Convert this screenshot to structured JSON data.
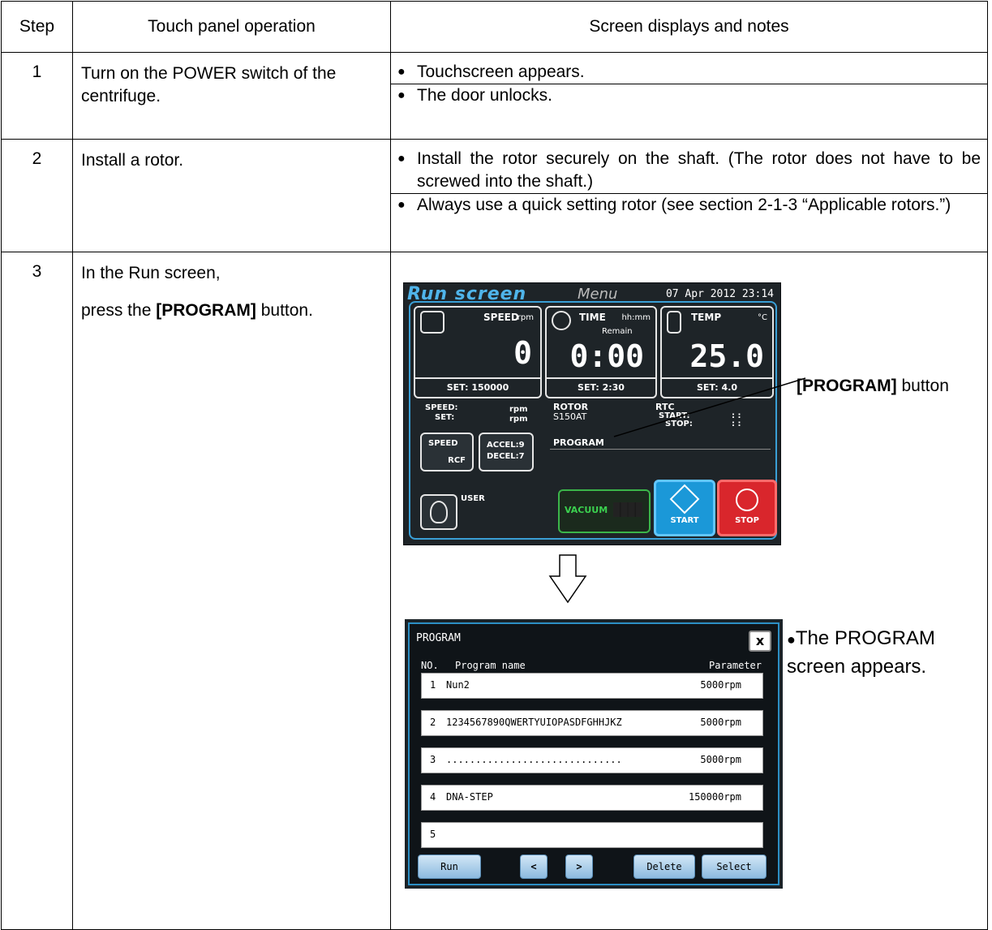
{
  "table": {
    "header": {
      "step": "Step",
      "operation": "Touch panel operation",
      "notes": "Screen displays and notes"
    },
    "rows": [
      {
        "step": "1",
        "operation": "Turn on the POWER switch of the centrifuge.",
        "notes": [
          "Touchscreen appears.",
          "The door unlocks."
        ]
      },
      {
        "step": "2",
        "operation": "Install a rotor.",
        "notes": [
          "Install the rotor securely on the shaft. (The rotor does not have to be screwed into the shaft.)",
          "Always use a quick setting rotor (see section 2-1-3 “Applicable rotors.”)"
        ]
      },
      {
        "step": "3",
        "operation_line1": "In the Run screen,",
        "operation_prefix": "press the ",
        "operation_bold": "[PROGRAM]",
        "operation_suffix": " button."
      }
    ]
  },
  "bullet_glyph": "●",
  "run_screen": {
    "tab_title": "Run screen",
    "tab_menu": "Menu",
    "clock": "07 Apr 2012 23:14",
    "speed": {
      "title": "SPEED",
      "unit": "rpm",
      "value": "0",
      "set": "SET: 150000"
    },
    "time": {
      "title": "TIME",
      "unit": "hh:mm",
      "sub": "Remain",
      "value": "0:00",
      "set": "SET: 2:30"
    },
    "temp": {
      "title": "TEMP",
      "unit": "°C",
      "value": "25.0",
      "set": "SET: 4.0"
    },
    "speed_label": "SPEED:",
    "set_label": "SET:",
    "rpm1": "rpm",
    "rpm2": "rpm",
    "rotor_label": "ROTOR",
    "rotor_value": "S150AT",
    "rtc_label": "RTC",
    "rtc_start": "START:",
    "rtc_stop": "STOP:",
    "rtc_start_val": ":  :",
    "rtc_stop_val": ":  :",
    "program_label": "PROGRAM",
    "btn_speed_top": "SPEED",
    "btn_speed_bottom": "RCF",
    "btn_accel": "ACCEL:9",
    "btn_decel": "DECEL:7",
    "user_label": "USER",
    "vacuum": "VACUUM",
    "start": "START",
    "stop": "STOP"
  },
  "callout": {
    "bold": "[PROGRAM]",
    "rest": " button"
  },
  "program_screen": {
    "title": "PROGRAM",
    "close": "x",
    "col_no": "NO.",
    "col_name": "Program name",
    "col_param": "Parameter",
    "rows": [
      {
        "no": "1",
        "name": "Nun2",
        "param": "5000rpm"
      },
      {
        "no": "2",
        "name": "1234567890QWERTYUIOPASDFGHHJKZ",
        "param": "5000rpm"
      },
      {
        "no": "3",
        "name": "..............................",
        "param": "5000rpm"
      },
      {
        "no": "4",
        "name": "DNA-STEP",
        "param": "150000rpm"
      },
      {
        "no": "5",
        "name": "",
        "param": ""
      }
    ],
    "buttons": {
      "run": "Run",
      "prev": "<",
      "next": ">",
      "delete": "Delete",
      "select": "Select"
    }
  },
  "program_note": "The PROGRAM screen appears."
}
